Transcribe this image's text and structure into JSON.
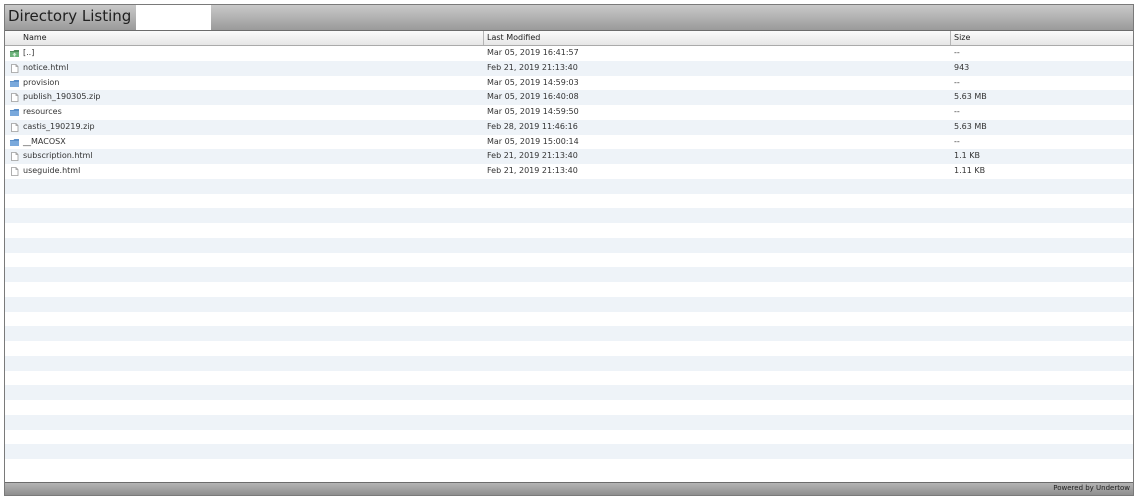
{
  "page": {
    "title": "Directory Listing –"
  },
  "columns": {
    "name": "Name",
    "modified": "Last Modified",
    "size": "Size"
  },
  "files": [
    {
      "icon": "up-directory-icon",
      "name": "[..]",
      "modified": "Mar 05, 2019 16:41:57",
      "size": "--"
    },
    {
      "icon": "file-icon",
      "name": "notice.html",
      "modified": "Feb 21, 2019 21:13:40",
      "size": "943"
    },
    {
      "icon": "folder-icon",
      "name": "provision",
      "modified": "Mar 05, 2019 14:59:03",
      "size": "--"
    },
    {
      "icon": "file-icon",
      "name": "publish_190305.zip",
      "modified": "Mar 05, 2019 16:40:08",
      "size": "5.63 MB"
    },
    {
      "icon": "folder-icon",
      "name": "resources",
      "modified": "Mar 05, 2019 14:59:50",
      "size": "--"
    },
    {
      "icon": "file-icon",
      "name": "castis_190219.zip",
      "modified": "Feb 28, 2019 11:46:16",
      "size": "5.63 MB"
    },
    {
      "icon": "folder-icon",
      "name": "__MACOSX",
      "modified": "Mar 05, 2019 15:00:14",
      "size": "--"
    },
    {
      "icon": "file-icon",
      "name": "subscription.html",
      "modified": "Feb 21, 2019 21:13:40",
      "size": "1.1 KB"
    },
    {
      "icon": "file-icon",
      "name": "useguide.html",
      "modified": "Feb 21, 2019 21:13:40",
      "size": "1.11 KB"
    }
  ],
  "footer": {
    "powered_by": "Powered by Undertow"
  },
  "colors": {
    "folder": "#5b8fc9",
    "alt_row": "#eef3f8"
  }
}
